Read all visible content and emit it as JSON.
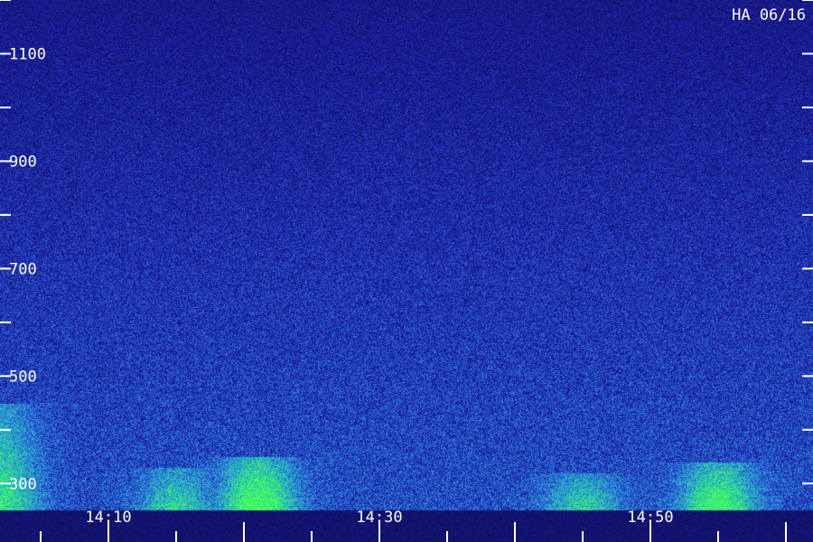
{
  "chart_data": {
    "type": "heatmap",
    "title": "HA 06/16",
    "xlabel": "",
    "ylabel": "",
    "x_ticks": [
      "14:10",
      "14:30",
      "14:50"
    ],
    "x_range": [
      "14:02",
      "15:02"
    ],
    "y_ticks": [
      300,
      500,
      700,
      900,
      1100
    ],
    "y_range": [
      250,
      1200
    ],
    "colormap": [
      "#0a0a3a",
      "#1a1a9a",
      "#2a5ad8",
      "#2aa8d8",
      "#2adf8a",
      "#4aff5a"
    ],
    "intensity_bands": [
      {
        "x": "14:02",
        "y": [
          250,
          450
        ],
        "level": 0.65
      },
      {
        "x": "14:15",
        "y": [
          250,
          330
        ],
        "level": 0.55
      },
      {
        "x": "14:21",
        "y": [
          250,
          350
        ],
        "level": 0.95
      },
      {
        "x": "14:45",
        "y": [
          250,
          320
        ],
        "level": 0.55
      },
      {
        "x": "14:55",
        "y": [
          250,
          340
        ],
        "level": 0.85
      }
    ]
  }
}
